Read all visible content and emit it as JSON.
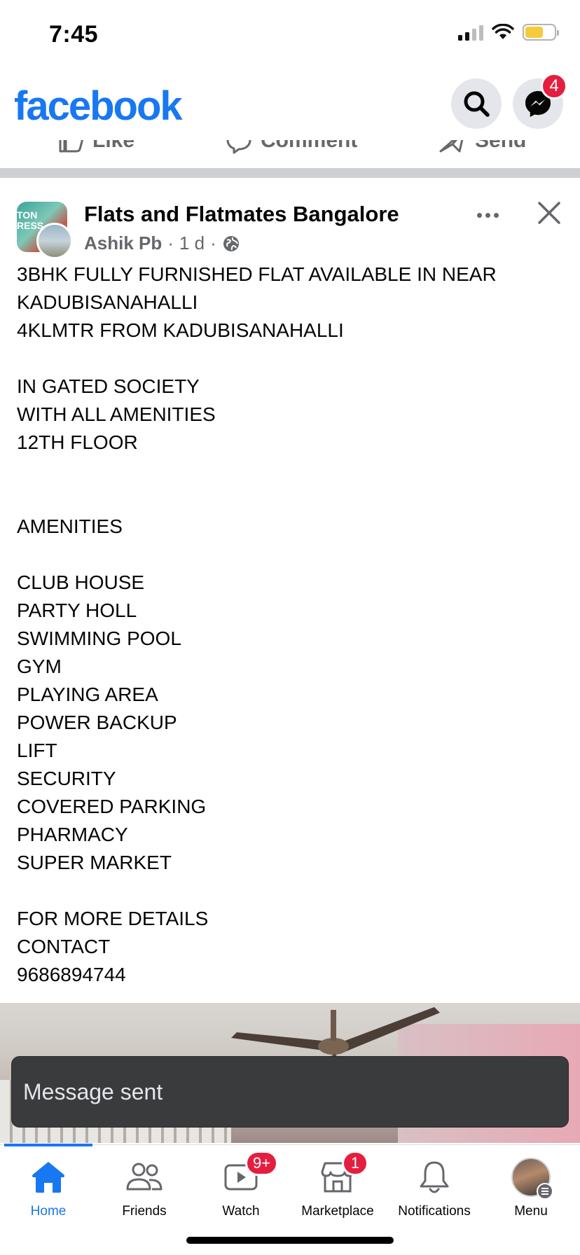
{
  "status_bar": {
    "time": "7:45"
  },
  "header": {
    "logo": "facebook",
    "messenger_badge": "4",
    "brand_color": "#1877f2"
  },
  "action_row": {
    "like_label": "Like",
    "comment_label": "Comment",
    "send_label": "Send"
  },
  "post": {
    "group_name": "Flats and Flatmates Bangalore",
    "author": "Ashik Pb",
    "separator": "·",
    "time": "1 d",
    "privacy_icon": "globe-icon",
    "body_lines": [
      "3BHK FULLY FURNISHED FLAT AVAILABLE IN NEAR",
      "KADUBISANAHALLI",
      "4KLMTR FROM KADUBISANAHALLI",
      "",
      "IN GATED SOCIETY",
      "WITH ALL AMENITIES",
      "12TH FLOOR",
      "",
      "",
      "AMENITIES",
      "",
      "CLUB HOUSE",
      "PARTY HOLL",
      "SWIMMING POOL",
      "GYM",
      "PLAYING AREA",
      "POWER BACKUP",
      "LIFT",
      "SECURITY",
      "COVERED PARKING",
      "PHARMACY",
      "SUPER MARKET",
      "",
      "FOR MORE DETAILS",
      "CONTACT",
      "9686894744"
    ]
  },
  "toast": {
    "message": "Message sent"
  },
  "tabbar": {
    "tabs": [
      {
        "label": "Home",
        "icon": "home-icon",
        "active": true
      },
      {
        "label": "Friends",
        "icon": "friends-icon"
      },
      {
        "label": "Watch",
        "icon": "watch-icon",
        "badge": "9+"
      },
      {
        "label": "Marketplace",
        "icon": "marketplace-icon",
        "badge": "1"
      },
      {
        "label": "Notifications",
        "icon": "bell-icon"
      },
      {
        "label": "Menu",
        "icon": "profile-avatar"
      }
    ]
  },
  "colors": {
    "accent": "#1877f2",
    "badge": "#e41e3f",
    "secondary_text": "#65676b",
    "toast_bg": "#3a3b3c"
  }
}
